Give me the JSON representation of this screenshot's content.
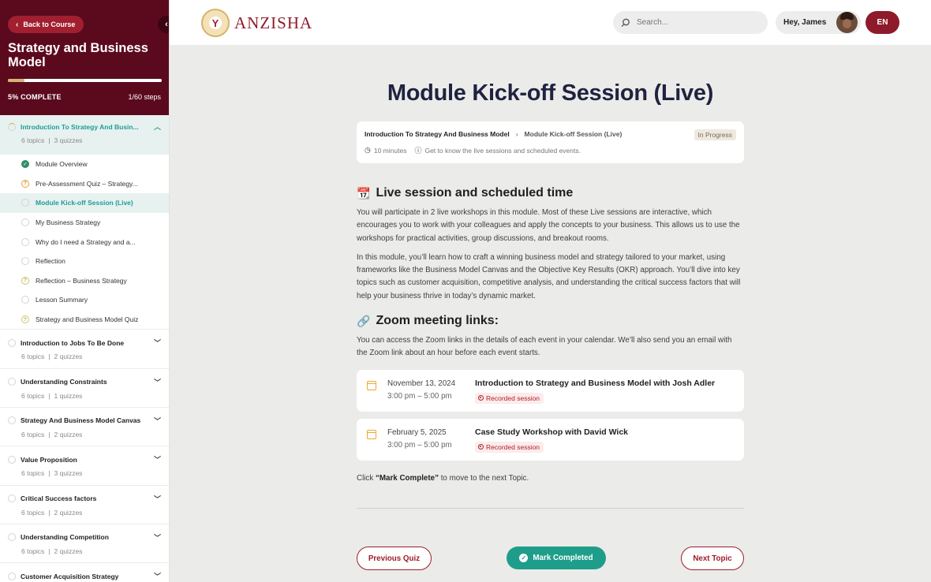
{
  "sidebar": {
    "back_label": "Back to Course",
    "course_title": "Strategy and Business Model",
    "progress": {
      "percent": 5,
      "complete_label": "5% COMPLETE",
      "steps_label": "1/60 steps"
    },
    "current_section": {
      "title": "Introduction To Strategy And Busin...",
      "topics": "6 topics",
      "quizzes": "3 quizzes",
      "lessons": [
        {
          "label": "Module Overview",
          "status": "done"
        },
        {
          "label": "Pre-Assessment Quiz – Strategy...",
          "status": "quiz"
        },
        {
          "label": "Module Kick-off Session (Live)",
          "status": "active"
        },
        {
          "label": "My Business Strategy",
          "status": "todo"
        },
        {
          "label": "Why do I need a Strategy and a...",
          "status": "todo"
        },
        {
          "label": "Reflection",
          "status": "todo"
        },
        {
          "label": "Reflection – Business Strategy",
          "status": "quiz2"
        },
        {
          "label": "Lesson Summary",
          "status": "todo"
        },
        {
          "label": "Strategy and Business Model Quiz",
          "status": "quiz2"
        }
      ]
    },
    "sections": [
      {
        "title": "Introduction to Jobs To Be Done",
        "topics": "6 topics",
        "quizzes": "2 quizzes"
      },
      {
        "title": "Understanding Constraints",
        "topics": "6 topics",
        "quizzes": "1 quizzes"
      },
      {
        "title": "Strategy And Business Model Canvas",
        "topics": "6 topics",
        "quizzes": "2 quizzes"
      },
      {
        "title": "Value Proposition",
        "topics": "6 topics",
        "quizzes": "3 quizzes"
      },
      {
        "title": "Critical Success factors",
        "topics": "6 topics",
        "quizzes": "2 quizzes"
      },
      {
        "title": "Understanding Competition",
        "topics": "6 topics",
        "quizzes": "2 quizzes"
      },
      {
        "title": "Customer Acquisition Strategy",
        "topics": "",
        "quizzes": ""
      }
    ]
  },
  "topbar": {
    "brand": "ANZISHA",
    "search_placeholder": "Search...",
    "greeting": "Hey, James",
    "language": "EN"
  },
  "main": {
    "title": "Module Kick-off Session (Live)",
    "breadcrumb": {
      "parent": "Introduction To Strategy And Business Model",
      "current": "Module Kick-off Session (Live)"
    },
    "status_badge": "In Progress",
    "duration": "10 minutes",
    "description": "Get to know the live sessions and scheduled events.",
    "live_heading": "Live session and scheduled time",
    "live_p1": "You will participate in 2 live workshops in this module. Most of these Live sessions are interactive, which encourages you to work with your colleagues and apply the concepts to your business. This allows us to use the workshops for practical activities, group discussions, and breakout rooms.",
    "live_p2": "In this module, you’ll learn how to craft a winning business model and strategy tailored to your market, using frameworks like the Business Model Canvas and the Objective Key Results (OKR) approach. You’ll dive into key topics such as customer acquisition, competitive analysis, and understanding the critical success factors that will help your business thrive in today’s dynamic market.",
    "zoom_heading": "Zoom meeting links:",
    "zoom_p": "You can access the Zoom links in the details of each event in your calendar. We’ll also send you an email with the Zoom link about an hour before each event starts.",
    "events": [
      {
        "date": "November 13, 2024",
        "time": "3:00 pm – 5:00 pm",
        "title": "Introduction to Strategy and Business Model with Josh Adler",
        "tag": "Recorded session"
      },
      {
        "date": "February 5, 2025",
        "time": "3:00 pm – 5:00 pm",
        "title": "Case Study Workshop with David Wick",
        "tag": "Recorded session"
      }
    ],
    "click_prefix": "Click ",
    "click_bold": "“Mark Complete”",
    "click_suffix": " to move to the next Topic."
  },
  "footer_nav": {
    "prev": "Previous Quiz",
    "mark": "Mark Completed",
    "next": "Next Topic"
  },
  "colors": {
    "brand": "#8e1b2b",
    "sidebar_header": "#5b0a1e",
    "accent_teal": "#1e9e94"
  }
}
